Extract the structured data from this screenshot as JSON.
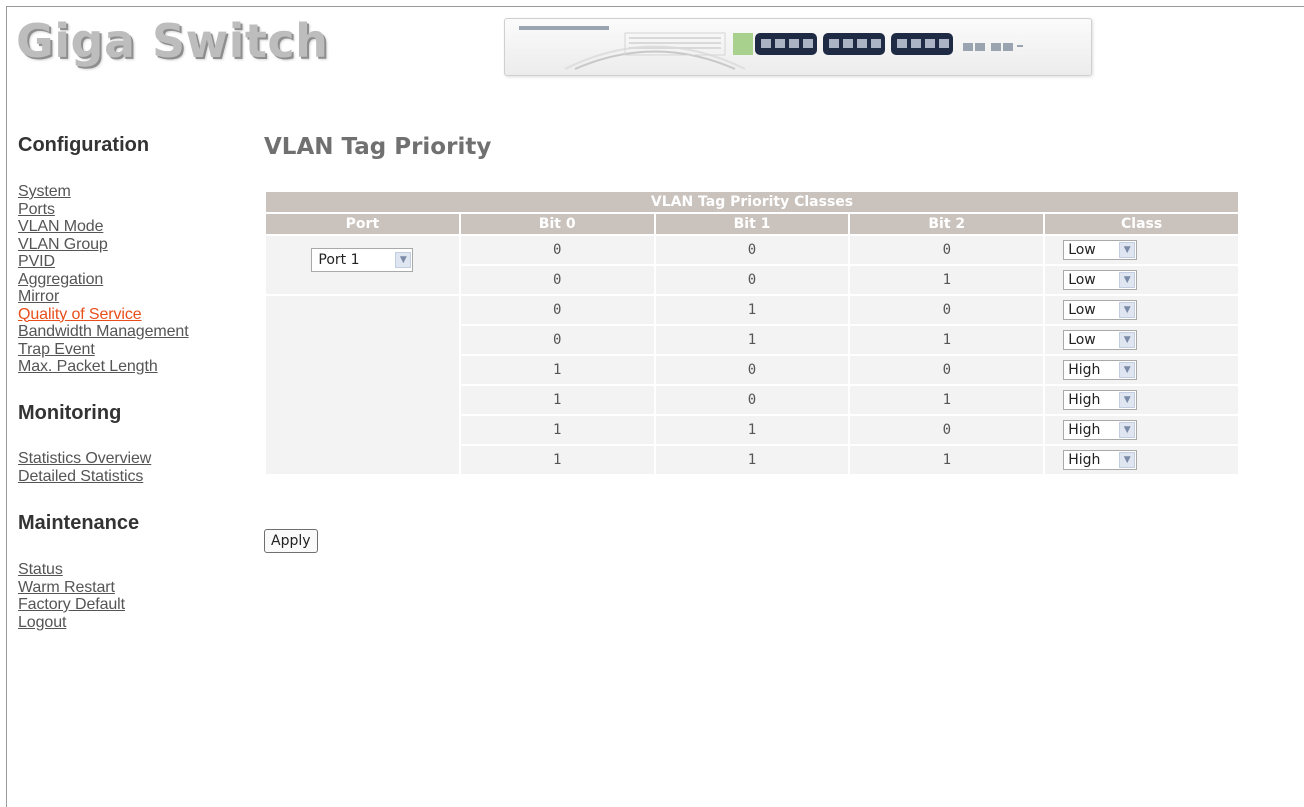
{
  "brand": "Giga Switch",
  "sidebar": {
    "configuration": {
      "heading": "Configuration",
      "items": [
        {
          "label": "System"
        },
        {
          "label": "Ports"
        },
        {
          "label": "VLAN Mode"
        },
        {
          "label": "VLAN Group"
        },
        {
          "label": "PVID"
        },
        {
          "label": "Aggregation"
        },
        {
          "label": "Mirror"
        },
        {
          "label": "Quality of Service",
          "active": true
        },
        {
          "label": "Bandwidth Management"
        },
        {
          "label": "Trap Event"
        },
        {
          "label": "Max. Packet Length"
        }
      ]
    },
    "monitoring": {
      "heading": "Monitoring",
      "items": [
        {
          "label": "Statistics Overview"
        },
        {
          "label": "Detailed Statistics"
        }
      ]
    },
    "maintenance": {
      "heading": "Maintenance",
      "items": [
        {
          "label": "Status"
        },
        {
          "label": "Warm Restart"
        },
        {
          "label": "Factory Default"
        },
        {
          "label": "Logout"
        }
      ]
    }
  },
  "main": {
    "title": "VLAN Tag Priority",
    "table": {
      "caption": "VLAN Tag Priority Classes",
      "columns": [
        "Port",
        "Bit 0",
        "Bit 1",
        "Bit 2",
        "Class"
      ],
      "port_select": "Port 1",
      "rows": [
        {
          "bit0": "0",
          "bit1": "0",
          "bit2": "0",
          "class": "Low"
        },
        {
          "bit0": "0",
          "bit1": "0",
          "bit2": "1",
          "class": "Low"
        },
        {
          "bit0": "0",
          "bit1": "1",
          "bit2": "0",
          "class": "Low"
        },
        {
          "bit0": "0",
          "bit1": "1",
          "bit2": "1",
          "class": "Low"
        },
        {
          "bit0": "1",
          "bit1": "0",
          "bit2": "0",
          "class": "High"
        },
        {
          "bit0": "1",
          "bit1": "0",
          "bit2": "1",
          "class": "High"
        },
        {
          "bit0": "1",
          "bit1": "1",
          "bit2": "0",
          "class": "High"
        },
        {
          "bit0": "1",
          "bit1": "1",
          "bit2": "1",
          "class": "High"
        }
      ]
    },
    "apply_label": "Apply"
  },
  "colors": {
    "header_bg": "#c9c2bd",
    "cell_bg": "#f3f3f3",
    "active_link": "#e84e1b",
    "title": "#707070"
  },
  "icons": {
    "select_arrow": "chevron-down-icon",
    "switch_image": "switch-device-image"
  }
}
